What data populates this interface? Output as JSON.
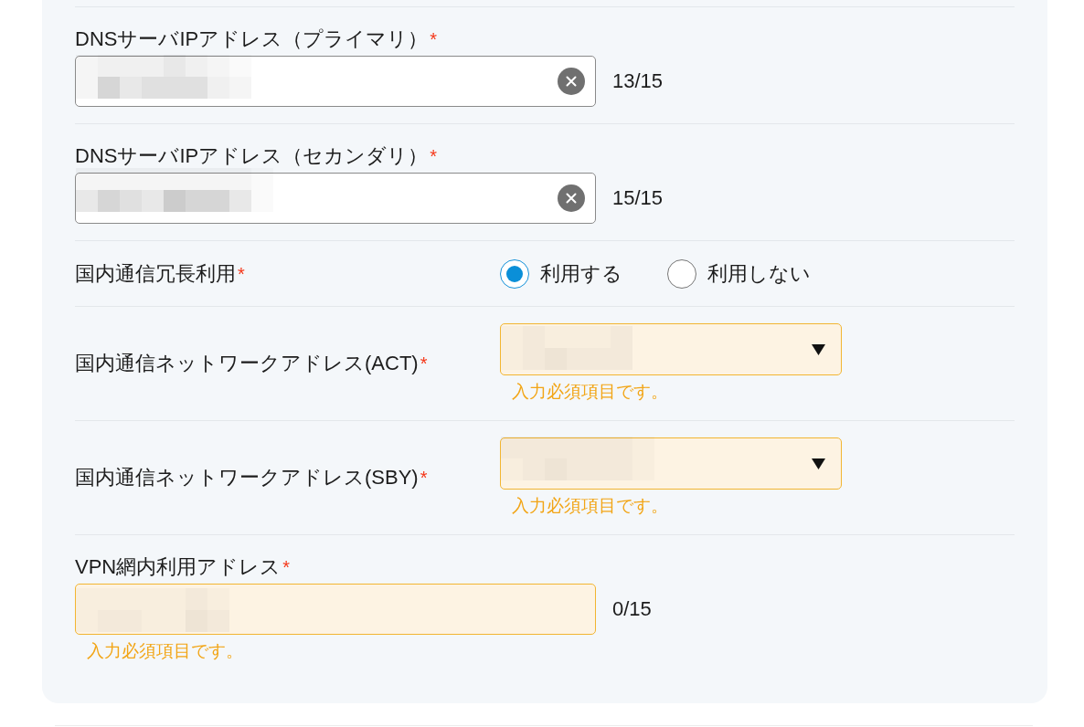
{
  "form": {
    "fields": [
      {
        "kind": "text",
        "label": "DNSサーバIPアドレス（プライマリ）",
        "required_mark": "*",
        "redacted": true,
        "clearable": true,
        "invalid": false,
        "counter": "13/15"
      },
      {
        "kind": "text",
        "label": "DNSサーバIPアドレス（セカンダリ）",
        "required_mark": "*",
        "redacted": true,
        "clearable": true,
        "invalid": false,
        "counter": "15/15"
      },
      {
        "kind": "radio",
        "label": "国内通信冗長利用",
        "required_mark": "*",
        "options": [
          {
            "label": "利用する",
            "selected": true
          },
          {
            "label": "利用しない",
            "selected": false
          }
        ]
      },
      {
        "kind": "select",
        "label": "国内通信ネットワークアドレス(ACT)",
        "required_mark": "*",
        "redacted": true,
        "invalid": true,
        "error": "入力必須項目です。"
      },
      {
        "kind": "select",
        "label": "国内通信ネットワークアドレス(SBY)",
        "required_mark": "*",
        "redacted": true,
        "invalid": true,
        "error": "入力必須項目です。"
      },
      {
        "kind": "text",
        "label": "VPN網内利用アドレス",
        "required_mark": "*",
        "redacted": true,
        "invalid": true,
        "counter": "0/15",
        "error": "入力必須項目です。"
      }
    ]
  }
}
